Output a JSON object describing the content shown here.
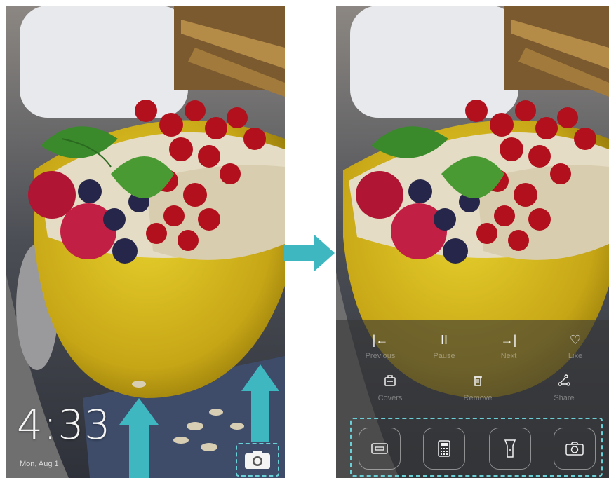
{
  "lock_screen": {
    "time": "4:33",
    "date": "Mon, Aug 1"
  },
  "shortcut_panel": {
    "music_controls": [
      {
        "label": "Previous",
        "icon": "skip-previous-icon",
        "glyph": "|←"
      },
      {
        "label": "Pause",
        "icon": "pause-icon",
        "glyph": "II"
      },
      {
        "label": "Next",
        "icon": "skip-next-icon",
        "glyph": "→|"
      },
      {
        "label": "Like",
        "icon": "heart-icon",
        "glyph": "♡"
      }
    ],
    "wallpaper_controls": [
      {
        "label": "Covers",
        "icon": "covers-icon"
      },
      {
        "label": "Remove",
        "icon": "trash-icon"
      },
      {
        "label": "Share",
        "icon": "share-icon"
      }
    ],
    "tools": [
      {
        "icon": "recorder-icon"
      },
      {
        "icon": "calculator-icon"
      },
      {
        "icon": "flashlight-icon"
      },
      {
        "icon": "camera-icon"
      }
    ]
  },
  "colors": {
    "accent_teal": "#3fb7c0",
    "highlight_dashed": "#6ad0d8"
  }
}
